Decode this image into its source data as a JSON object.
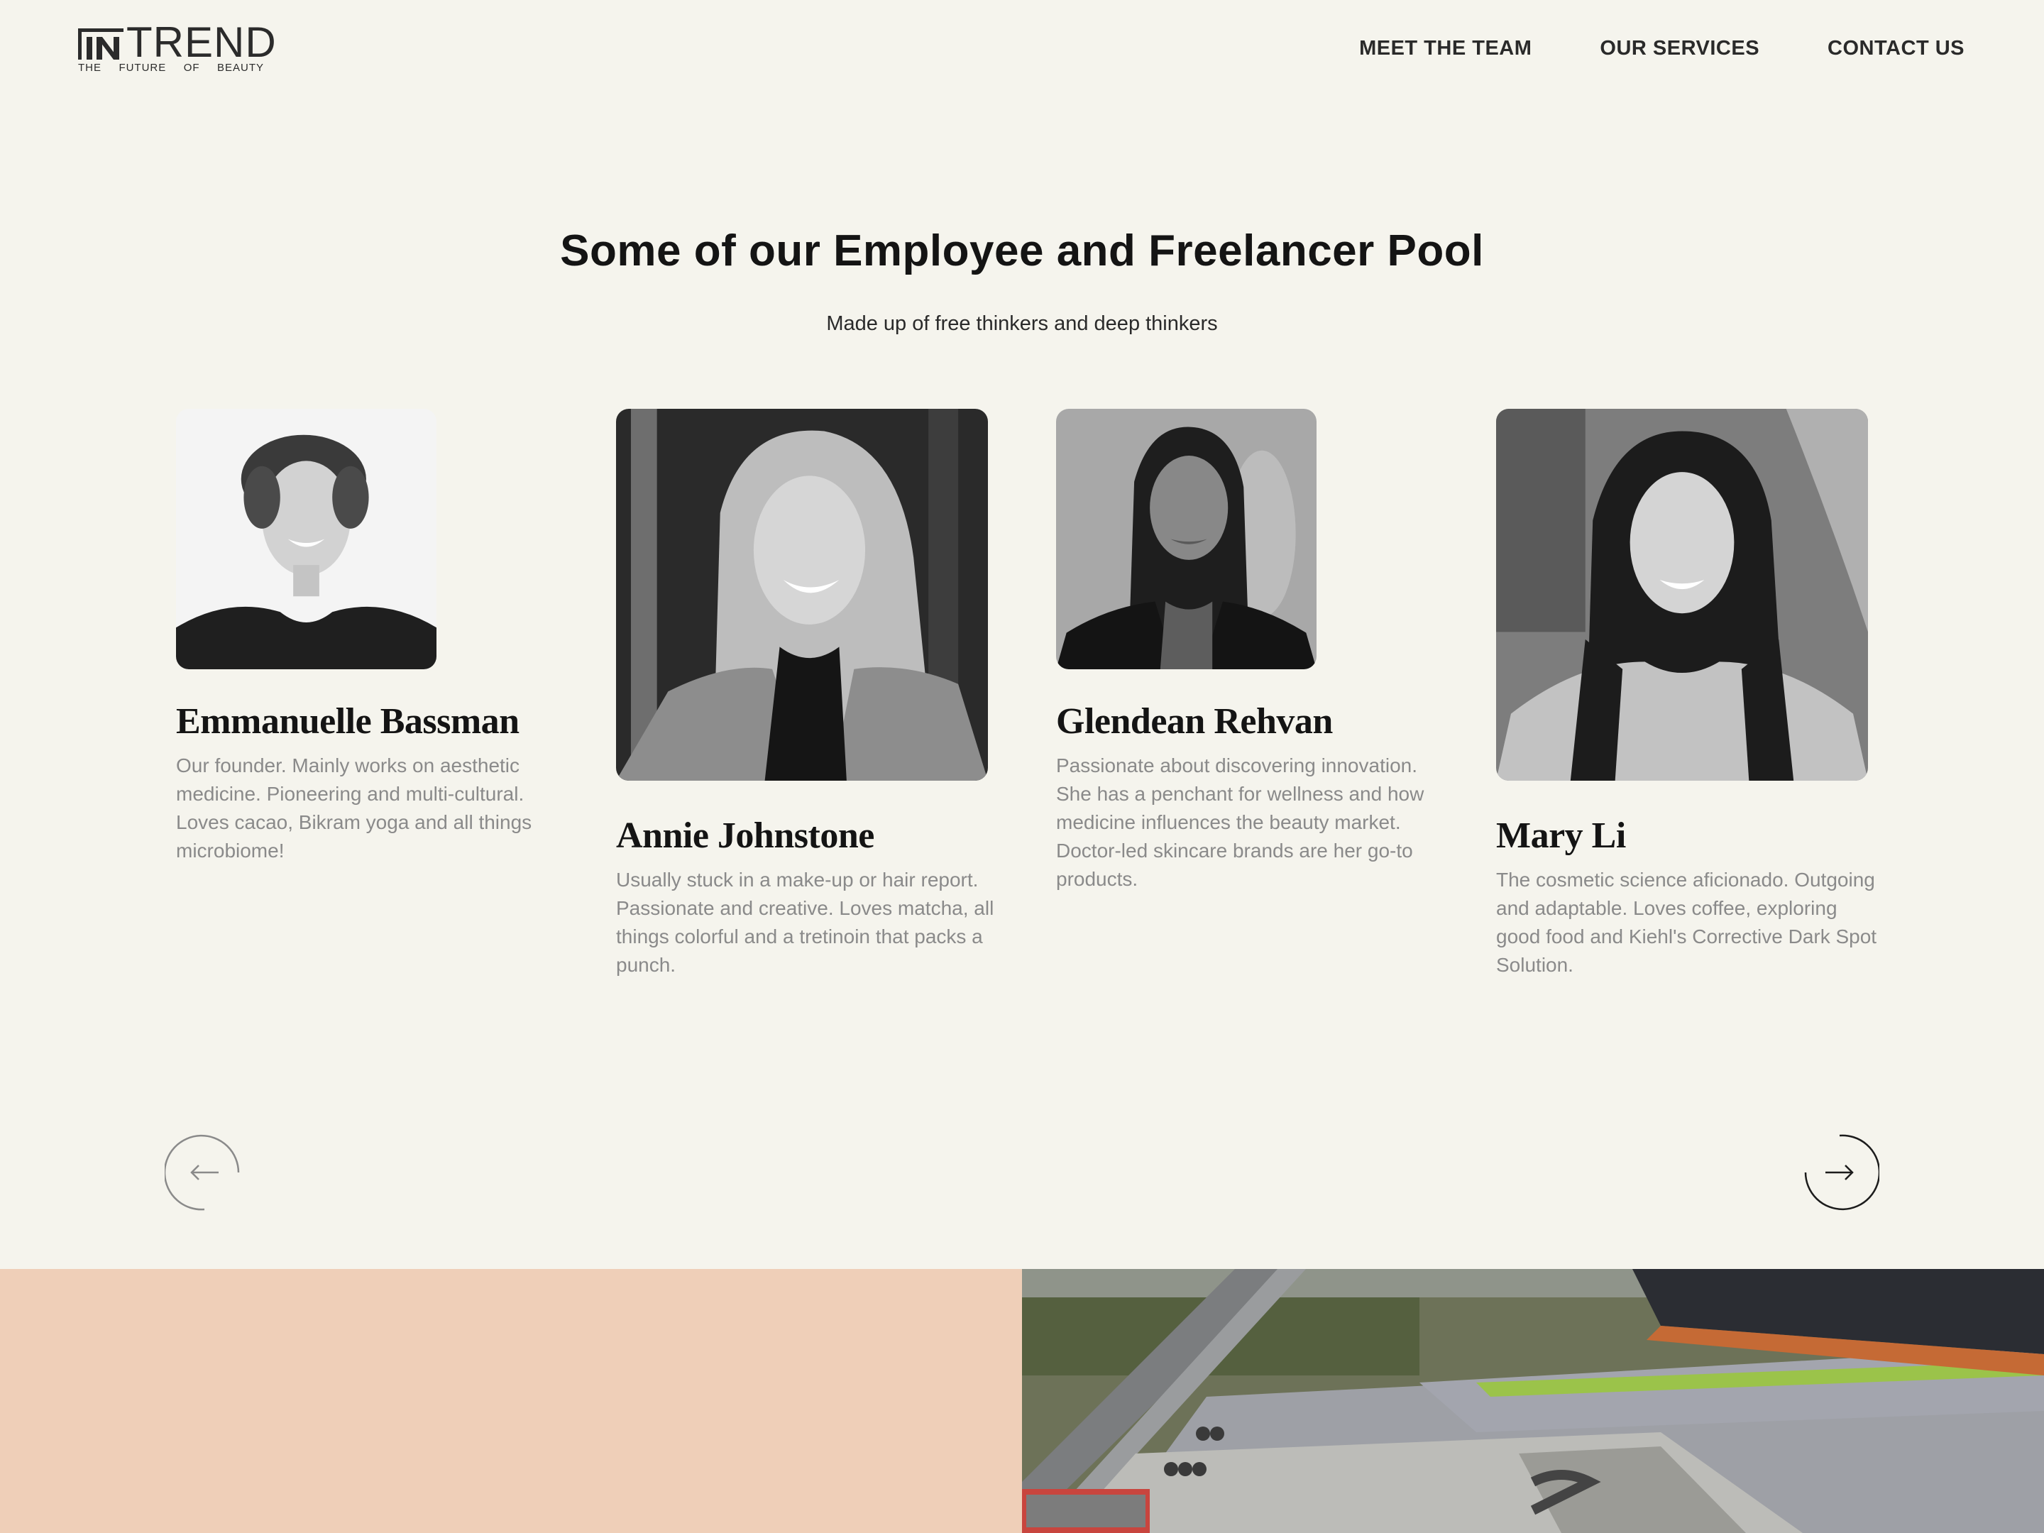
{
  "brand": {
    "logo_mark": "IN",
    "logo_word": "TREND",
    "tagline": [
      "THE",
      "FUTURE",
      "OF",
      "BEAUTY"
    ]
  },
  "nav": {
    "items": [
      {
        "label": "MEET THE TEAM"
      },
      {
        "label": "OUR SERVICES"
      },
      {
        "label": "CONTACT US"
      }
    ]
  },
  "section": {
    "title": "Some of our Employee and Freelancer Pool",
    "subtitle": "Made up of free thinkers and deep thinkers"
  },
  "team": [
    {
      "name": "Emmanuelle Bassman",
      "bio": "Our founder. Mainly works on aesthetic medicine. Pioneering and multi-cultural. Loves cacao, Bikram yoga and all things microbiome!"
    },
    {
      "name": "Annie Johnstone",
      "bio": "Usually stuck in a make-up or hair report. Passionate and creative. Loves matcha, all things colorful and a tretinoin that packs a punch."
    },
    {
      "name": "Glendean Rehvan",
      "bio": "Passionate about discovering innovation. She has a penchant for wellness and how medicine influences the beauty market. Doctor-led skincare brands are her go-to products."
    },
    {
      "name": "Mary Li",
      "bio": "The cosmetic science aficionado. Outgoing and adaptable. Loves coffee, exploring good food and Kiehl's Corrective Dark Spot Solution."
    }
  ],
  "carousel": {
    "prev_icon": "arrow-left-icon",
    "next_icon": "arrow-right-icon"
  },
  "colors": {
    "background": "#f5f4ed",
    "band": "#efcfb8",
    "heading": "#141414",
    "muted_text": "#8a8a8a"
  }
}
